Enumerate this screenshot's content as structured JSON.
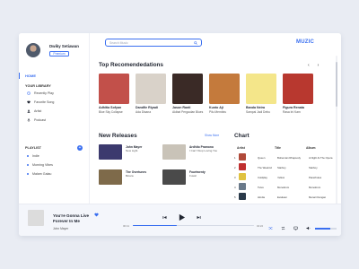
{
  "user": {
    "name": "Dwiky Setiawan",
    "badge": "Premium"
  },
  "search": {
    "placeholder": "Search Music"
  },
  "logo": "MUZIC",
  "nav": {
    "home": "HOME",
    "library_label": "YOUR LIBRARY",
    "library": [
      "Recently Play",
      "Favorite Song",
      "Artist",
      "Podcast"
    ],
    "playlist_label": "PLAYLIST",
    "playlists": [
      "Indie",
      "Morning Vibes",
      "Malam Galau"
    ]
  },
  "recommendations": {
    "title": "Top Recomendedations",
    "items": [
      {
        "title": "Adhitia Sofyan",
        "artist": "Blue Sky Collapse",
        "color": "#c2504a"
      },
      {
        "title": "Dandfie Riyadi",
        "artist": "Ada Disana",
        "color": "#d9d2c9"
      },
      {
        "title": "Jason Ranti",
        "artist": "Akibat Pergaulan Blues",
        "color": "#3a2a26"
      },
      {
        "title": "Kunto Aji",
        "artist": "Pilu Membiru",
        "color": "#c47a3c"
      },
      {
        "title": "Banda Neira",
        "artist": "Sampai Jadi Debu",
        "color": "#f4e68a"
      },
      {
        "title": "Figura Renata",
        "artist": "Rasa Ini Kam",
        "color": "#b8382f"
      }
    ]
  },
  "new_releases": {
    "title": "New Releases",
    "show_more": "Show More",
    "items": [
      {
        "title": "John Mayer",
        "artist": "New Light",
        "color": "#3c3a6e"
      },
      {
        "title": "Ardhito Pramono",
        "artist": "I Can't Stop Loving You",
        "color": "#c9c3b8"
      },
      {
        "title": "The Overtunes",
        "artist": "Bicara",
        "color": "#7e6a4a"
      },
      {
        "title": "Fourtwenty",
        "artist": "Fussil",
        "color": "#4a4a4a"
      }
    ]
  },
  "chart": {
    "title": "Chart",
    "headers": [
      "Artist",
      "Title",
      "Album"
    ],
    "rows": [
      {
        "num": "1",
        "artist": "Queen",
        "title": "Bohemian Rhapsody",
        "album": "A Night At The Opera",
        "color": "#b04a3a"
      },
      {
        "num": "2",
        "artist": "The Weeknd",
        "title": "Starboy",
        "album": "Starboy",
        "color": "#c03030"
      },
      {
        "num": "3",
        "artist": "Coldplay",
        "title": "Yellow",
        "album": "Parachutes",
        "color": "#e0c240"
      },
      {
        "num": "4",
        "artist": "Tulus",
        "title": "Monokrom",
        "album": "Monokrom",
        "color": "#6a7a8a"
      },
      {
        "num": "5",
        "artist": "Hindia",
        "title": "Evaluasi",
        "album": "Menari Dengan",
        "color": "#2a3a4a"
      }
    ]
  },
  "player": {
    "title": "You're Gonna Live Forever In Me",
    "artist": "John Mayer",
    "elapsed": "00:41",
    "duration": "04:22",
    "progress": 0.36,
    "volume": 0.7
  },
  "colors": {
    "accent": "#3a6ff0"
  }
}
